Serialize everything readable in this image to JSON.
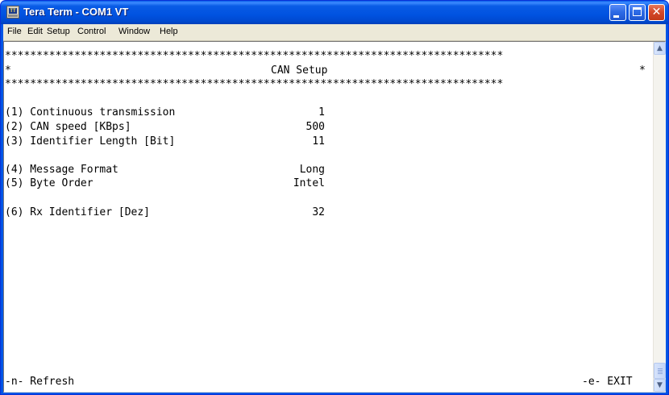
{
  "window": {
    "title": "Tera Term - COM1 VT",
    "icon": "teraterm-app-icon",
    "controls": {
      "minimize": "minimize-icon",
      "maximize": "maximize-icon",
      "close": "close-icon"
    }
  },
  "menu": {
    "items": [
      "File",
      "Edit",
      "Setup",
      "Control",
      "Window",
      "Help"
    ]
  },
  "terminal": {
    "border_line": "*******************************************************************************",
    "header_left": "*",
    "header_title": "CAN Setup",
    "header_right": "*",
    "params": [
      {
        "label": "(1) Continuous transmission",
        "value": "1"
      },
      {
        "label": "(2) CAN speed [KBps]",
        "value": "500"
      },
      {
        "label": "(3) Identifier Length [Bit]",
        "value": "11"
      },
      {
        "label": "(4) Message Format",
        "value": "Long"
      },
      {
        "label": "(5) Byte Order",
        "value": "Intel"
      },
      {
        "label": "(6) Rx Identifier [Dez]",
        "value": "32"
      }
    ],
    "footer_left": "-n- Refresh",
    "footer_right": "-e- EXIT"
  },
  "colors": {
    "titlebar": "#0054e3",
    "close_button": "#d6492a",
    "menubar": "#ece9d8",
    "terminal_bg": "#ffffff",
    "terminal_fg": "#000000"
  }
}
